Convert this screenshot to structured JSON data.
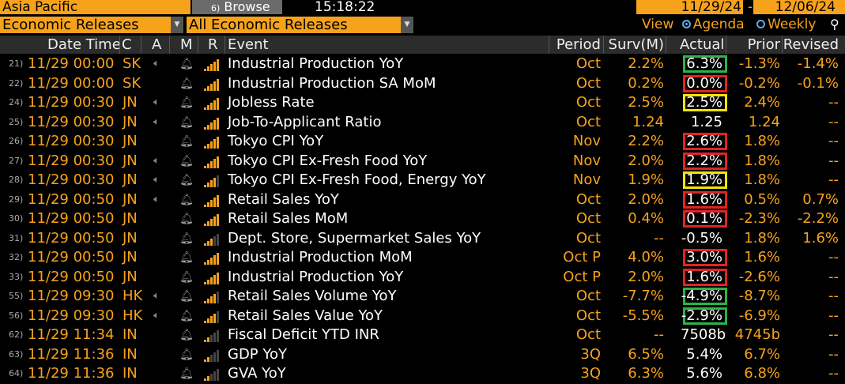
{
  "topbar": {
    "region": "Asia Pacific",
    "browse_num": "6)",
    "browse_label": "Browse",
    "clock": "15:18:22",
    "date_from": "11/29/24",
    "date_sep": "-",
    "date_to": "12/06/24"
  },
  "filters": {
    "type": "Economic Releases",
    "subtype": "All Economic Releases"
  },
  "view": {
    "label": "View",
    "agenda": "Agenda",
    "weekly": "Weekly"
  },
  "columns": {
    "date_time": "Date Time",
    "country": "C",
    "alert": "A",
    "monitor": "M",
    "relevance": "R",
    "event": "Event",
    "period": "Period",
    "survey": "Surv(M)",
    "actual": "Actual",
    "prior": "Prior",
    "revised": "Revised"
  },
  "colors": {
    "accent": "#f7a21b",
    "box_red": "#e02424",
    "box_green": "#2db34a",
    "box_yellow": "#f2e500"
  },
  "rows": [
    {
      "idx": "21)",
      "datetime": "11/29 00:00",
      "country": "SK",
      "alert": true,
      "relevance": 4,
      "event": "Industrial Production YoY",
      "period": "Oct",
      "survey": "2.2%",
      "actual": "6.3%",
      "prior": "-1.3%",
      "revised": "-1.4%",
      "box": "green"
    },
    {
      "idx": "22)",
      "datetime": "11/29 00:00",
      "country": "SK",
      "alert": false,
      "relevance": 4,
      "event": "Industrial Production SA MoM",
      "period": "Oct",
      "survey": "0.2%",
      "actual": "0.0%",
      "prior": "-0.2%",
      "revised": "-0.1%",
      "box": "red"
    },
    {
      "idx": "24)",
      "datetime": "11/29 00:30",
      "country": "JN",
      "alert": true,
      "relevance": 4,
      "event": "Jobless Rate",
      "period": "Oct",
      "survey": "2.5%",
      "actual": "2.5%",
      "prior": "2.4%",
      "revised": "--",
      "box": "yellow"
    },
    {
      "idx": "25)",
      "datetime": "11/29 00:30",
      "country": "JN",
      "alert": true,
      "relevance": 4,
      "event": "Job-To-Applicant Ratio",
      "period": "Oct",
      "survey": "1.24",
      "actual": "1.25",
      "prior": "1.24",
      "revised": "--",
      "box": ""
    },
    {
      "idx": "26)",
      "datetime": "11/29 00:30",
      "country": "JN",
      "alert": false,
      "relevance": 4,
      "event": "Tokyo CPI YoY",
      "period": "Nov",
      "survey": "2.2%",
      "actual": "2.6%",
      "prior": "1.8%",
      "revised": "--",
      "box": "red"
    },
    {
      "idx": "27)",
      "datetime": "11/29 00:30",
      "country": "JN",
      "alert": true,
      "relevance": 4,
      "event": "Tokyo CPI Ex-Fresh Food YoY",
      "period": "Nov",
      "survey": "2.0%",
      "actual": "2.2%",
      "prior": "1.8%",
      "revised": "--",
      "box": "red"
    },
    {
      "idx": "28)",
      "datetime": "11/29 00:30",
      "country": "JN",
      "alert": true,
      "relevance": 3,
      "event": "Tokyo CPI Ex-Fresh Food, Energy YoY",
      "period": "Nov",
      "survey": "1.9%",
      "actual": "1.9%",
      "prior": "1.8%",
      "revised": "--",
      "box": "yellow"
    },
    {
      "idx": "29)",
      "datetime": "11/29 00:50",
      "country": "JN",
      "alert": true,
      "relevance": 4,
      "event": "Retail Sales YoY",
      "period": "Oct",
      "survey": "2.0%",
      "actual": "1.6%",
      "prior": "0.5%",
      "revised": "0.7%",
      "box": "red"
    },
    {
      "idx": "30)",
      "datetime": "11/29 00:50",
      "country": "JN",
      "alert": false,
      "relevance": 4,
      "event": "Retail Sales MoM",
      "period": "Oct",
      "survey": "0.4%",
      "actual": "0.1%",
      "prior": "-2.3%",
      "revised": "-2.2%",
      "box": "red"
    },
    {
      "idx": "31)",
      "datetime": "11/29 00:50",
      "country": "JN",
      "alert": false,
      "relevance": 2,
      "event": "Dept. Store, Supermarket Sales YoY",
      "period": "Oct",
      "survey": "--",
      "actual": "-0.5%",
      "prior": "1.8%",
      "revised": "1.6%",
      "box": ""
    },
    {
      "idx": "32)",
      "datetime": "11/29 00:50",
      "country": "JN",
      "alert": false,
      "relevance": 4,
      "event": "Industrial Production MoM",
      "period": "Oct P",
      "survey": "4.0%",
      "actual": "3.0%",
      "prior": "1.6%",
      "revised": "--",
      "box": "red"
    },
    {
      "idx": "33)",
      "datetime": "11/29 00:50",
      "country": "JN",
      "alert": false,
      "relevance": 4,
      "event": "Industrial Production YoY",
      "period": "Oct P",
      "survey": "2.0%",
      "actual": "1.6%",
      "prior": "-2.6%",
      "revised": "--",
      "box": "red"
    },
    {
      "idx": "55)",
      "datetime": "11/29 09:30",
      "country": "HK",
      "alert": true,
      "relevance": 3,
      "event": "Retail Sales Volume YoY",
      "period": "Oct",
      "survey": "-7.7%",
      "actual": "-4.9%",
      "prior": "-8.7%",
      "revised": "--",
      "box": "green"
    },
    {
      "idx": "56)",
      "datetime": "11/29 09:30",
      "country": "HK",
      "alert": true,
      "relevance": 3,
      "event": "Retail Sales Value YoY",
      "period": "Oct",
      "survey": "-5.5%",
      "actual": "-2.9%",
      "prior": "-6.9%",
      "revised": "--",
      "box": "green"
    },
    {
      "idx": "62)",
      "datetime": "11/29 11:34",
      "country": "IN",
      "alert": false,
      "relevance": 1,
      "event": "Fiscal Deficit YTD INR",
      "period": "Oct",
      "survey": "--",
      "actual": "7508b",
      "prior": "4745b",
      "revised": "--",
      "box": ""
    },
    {
      "idx": "63)",
      "datetime": "11/29 11:36",
      "country": "IN",
      "alert": false,
      "relevance": 1,
      "event": "GDP YoY",
      "period": "3Q",
      "survey": "6.5%",
      "actual": "5.4%",
      "prior": "6.7%",
      "revised": "--",
      "box": ""
    },
    {
      "idx": "64)",
      "datetime": "11/29 11:36",
      "country": "IN",
      "alert": false,
      "relevance": 1,
      "event": "GVA YoY",
      "period": "3Q",
      "survey": "6.3%",
      "actual": "5.6%",
      "prior": "6.8%",
      "revised": "--",
      "box": ""
    }
  ]
}
